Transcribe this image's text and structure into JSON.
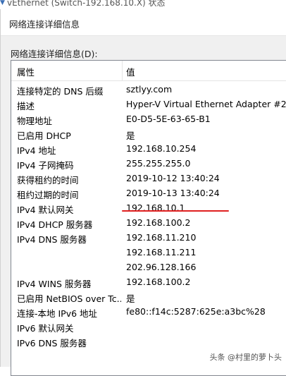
{
  "outer_window": {
    "title": "vEthernet (Switch-192.168.10.X) 状态"
  },
  "dialog": {
    "title": "网络连接详细信息",
    "group_label": "网络连接详细信息(D):"
  },
  "table": {
    "header": {
      "property": "属性",
      "value": "值"
    },
    "rows": [
      {
        "property": "连接特定的 DNS 后缀",
        "value": "sztlyy.com"
      },
      {
        "property": "描述",
        "value": "Hyper-V Virtual Ethernet Adapter #2"
      },
      {
        "property": "物理地址",
        "value": "E0-D5-5E-63-65-B1"
      },
      {
        "property": "已启用 DHCP",
        "value": "是"
      },
      {
        "property": "IPv4 地址",
        "value": "192.168.10.254"
      },
      {
        "property": "IPv4 子网掩码",
        "value": "255.255.255.0"
      },
      {
        "property": "获得租约的时间",
        "value": "2019-10-12 13:40:24"
      },
      {
        "property": "租约过期的时间",
        "value": "2019-10-13 13:40:24"
      },
      {
        "property": "IPv4 默认网关",
        "value": "192.168.10.1"
      },
      {
        "property": "IPv4 DHCP 服务器",
        "value": "192.168.100.2"
      },
      {
        "property": "IPv4 DNS 服务器",
        "value": "192.168.11.210"
      },
      {
        "property": "",
        "value": "192.168.11.211"
      },
      {
        "property": "",
        "value": "202.96.128.166"
      },
      {
        "property": "IPv4 WINS 服务器",
        "value": "192.168.100.2"
      },
      {
        "property": "已启用 NetBIOS over Tc...",
        "value": "是"
      },
      {
        "property": "连接-本地 IPv6 地址",
        "value": "fe80::f14c:5287:625e:a3bc%28"
      },
      {
        "property": "IPv6 默认网关",
        "value": ""
      },
      {
        "property": "IPv6 DNS 服务器",
        "value": ""
      }
    ]
  },
  "annotation": {
    "color": "#e02020"
  },
  "watermark": "头条 @村里的萝卜头"
}
